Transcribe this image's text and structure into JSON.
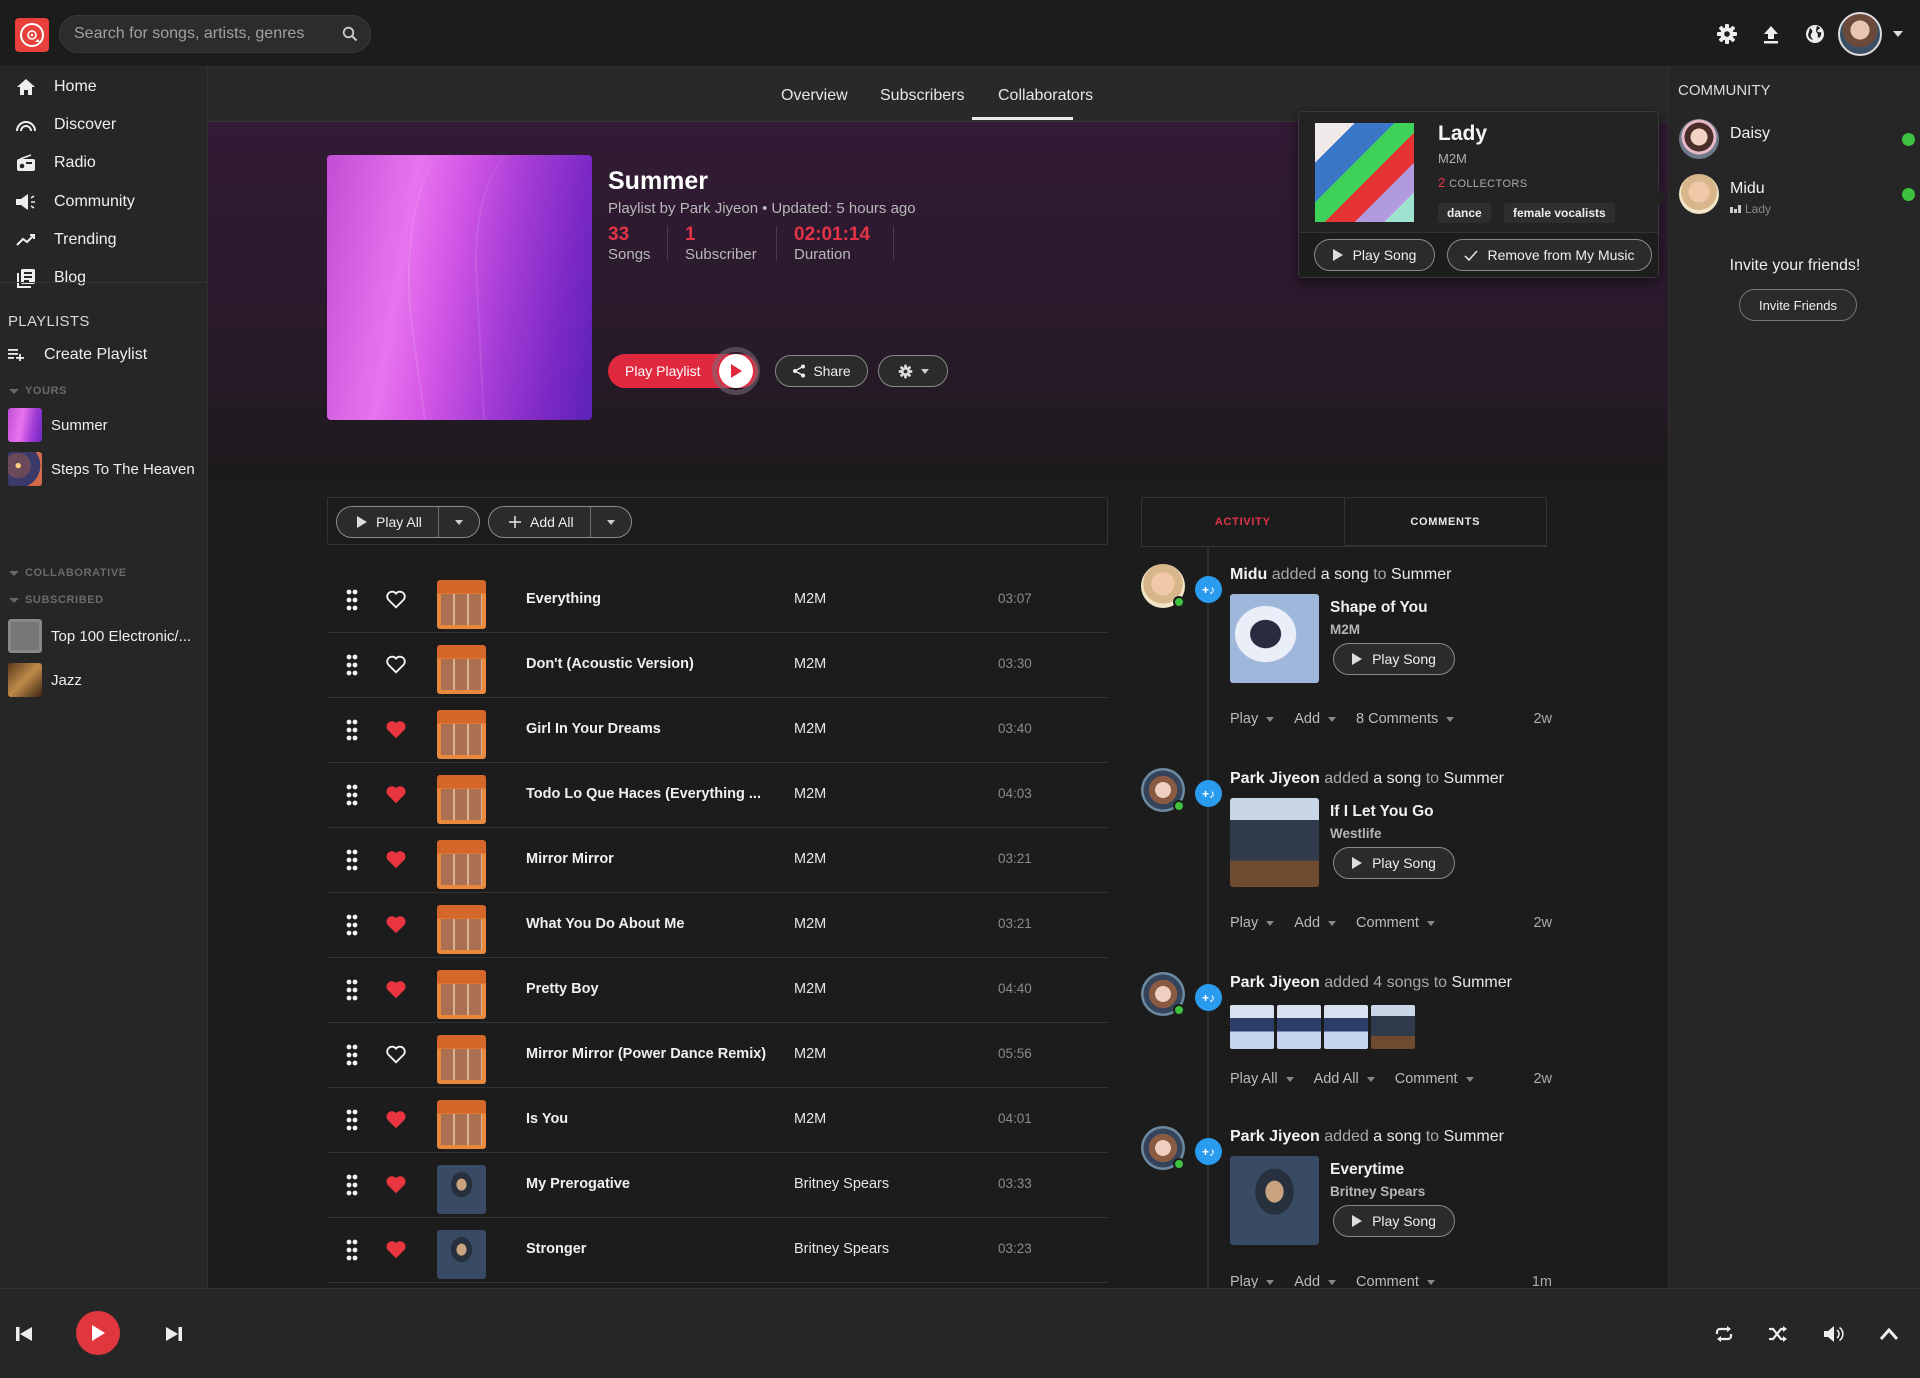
{
  "header": {
    "search_placeholder": "Search for songs, artists, genres",
    "icons": [
      "settings-icon",
      "upload-icon",
      "globe-icon",
      "avatar"
    ]
  },
  "sidebar": {
    "nav": [
      {
        "label": "Home",
        "icon": "home-icon"
      },
      {
        "label": "Discover",
        "icon": "discover-icon"
      },
      {
        "label": "Radio",
        "icon": "radio-icon"
      },
      {
        "label": "Community",
        "icon": "megaphone-icon"
      },
      {
        "label": "Trending",
        "icon": "trending-icon"
      },
      {
        "label": "Blog",
        "icon": "blog-icon"
      }
    ],
    "playlists_heading": "PLAYLISTS",
    "create_playlist": "Create Playlist",
    "sections": {
      "yours": "YOURS",
      "collaborative": "COLLABORATIVE",
      "subscribed": "SUBSCRIBED"
    },
    "yours": [
      {
        "label": "Summer"
      },
      {
        "label": "Steps To The Heaven"
      }
    ],
    "subscribed": [
      {
        "label": "Top 100 Electronic/..."
      },
      {
        "label": "Jazz"
      }
    ]
  },
  "tabs": [
    {
      "label": "Overview",
      "active": true
    },
    {
      "label": "Subscribers",
      "active": false
    },
    {
      "label": "Collaborators",
      "active": false
    }
  ],
  "playlist": {
    "title": "Summer",
    "by": "Playlist by Park Jiyeon",
    "updated": "Updated: 5 hours ago",
    "stats": [
      {
        "value": "33",
        "label": "Songs"
      },
      {
        "value": "1",
        "label": "Subscriber"
      },
      {
        "value": "02:01:14",
        "label": "Duration"
      }
    ],
    "play_label": "Play Playlist",
    "share_label": "Share"
  },
  "toolbar": {
    "play_all": "Play All",
    "add_all": "Add All"
  },
  "songs": [
    {
      "title": "Everything",
      "artist": "M2M",
      "duration": "03:07",
      "liked": false,
      "art": "m2m"
    },
    {
      "title": "Don't (Acoustic Version)",
      "artist": "M2M",
      "duration": "03:30",
      "liked": false,
      "art": "m2m"
    },
    {
      "title": "Girl In Your Dreams",
      "artist": "M2M",
      "duration": "03:40",
      "liked": true,
      "art": "m2m"
    },
    {
      "title": "Todo Lo Que Haces (Everything ...",
      "artist": "M2M",
      "duration": "04:03",
      "liked": true,
      "art": "m2m"
    },
    {
      "title": "Mirror Mirror",
      "artist": "M2M",
      "duration": "03:21",
      "liked": true,
      "art": "m2m"
    },
    {
      "title": "What You Do About Me",
      "artist": "M2M",
      "duration": "03:21",
      "liked": true,
      "art": "m2m"
    },
    {
      "title": "Pretty Boy",
      "artist": "M2M",
      "duration": "04:40",
      "liked": true,
      "art": "m2m"
    },
    {
      "title": "Mirror Mirror (Power Dance Remix)",
      "artist": "M2M",
      "duration": "05:56",
      "liked": false,
      "art": "m2m"
    },
    {
      "title": "Is You",
      "artist": "M2M",
      "duration": "04:01",
      "liked": true,
      "art": "m2m"
    },
    {
      "title": "My Prerogative",
      "artist": "Britney Spears",
      "duration": "03:33",
      "liked": true,
      "art": "brit"
    },
    {
      "title": "Stronger",
      "artist": "Britney Spears",
      "duration": "03:23",
      "liked": true,
      "art": "brit"
    }
  ],
  "activity": {
    "tabs": [
      {
        "label": "ACTIVITY",
        "active": true
      },
      {
        "label": "COMMENTS",
        "active": false
      }
    ],
    "items": [
      {
        "user": "Midu",
        "verb": "added",
        "object": "a song",
        "prep": "to",
        "target": "Summer",
        "song_title": "Shape of You",
        "song_artist": "M2M",
        "play_label": "Play Song",
        "actions": [
          "Play",
          "Add",
          "8 Comments"
        ],
        "time": "2w"
      },
      {
        "user": "Park Jiyeon",
        "verb": "added",
        "object": "a song",
        "prep": "to",
        "target": "Summer",
        "song_title": "If I Let You Go",
        "song_artist": "Westlife",
        "play_label": "Play Song",
        "actions": [
          "Play",
          "Add",
          "Comment"
        ],
        "time": "2w"
      },
      {
        "user": "Park Jiyeon",
        "verb": "added",
        "object": "4 songs",
        "prep": "to",
        "target": "Summer",
        "actions": [
          "Play All",
          "Add All",
          "Comment"
        ],
        "time": "2w"
      },
      {
        "user": "Park Jiyeon",
        "verb": "added",
        "object": "a song",
        "prep": "to",
        "target": "Summer",
        "song_title": "Everytime",
        "song_artist": "Britney Spears",
        "play_label": "Play Song",
        "actions": [
          "Play",
          "Add",
          "Comment"
        ],
        "time": "1m"
      }
    ]
  },
  "song_card": {
    "title": "Lady",
    "artist": "M2M",
    "collectors_count": "2",
    "collectors_label": "COLLECTORS",
    "tags": [
      "dance",
      "female vocalists"
    ],
    "play_label": "Play Song",
    "remove_label": "Remove from My Music"
  },
  "community": {
    "heading": "COMMUNITY",
    "friends": [
      {
        "name": "Daisy",
        "listening": "",
        "online": true
      },
      {
        "name": "Midu",
        "listening": "Lady",
        "online": true
      }
    ],
    "invite_text": "Invite your friends!",
    "invite_button": "Invite Friends"
  },
  "colors": {
    "accent": "#e0283f",
    "logo": "#e8413b",
    "online": "#3ec13e",
    "activity_badge": "#2a9cf0"
  }
}
